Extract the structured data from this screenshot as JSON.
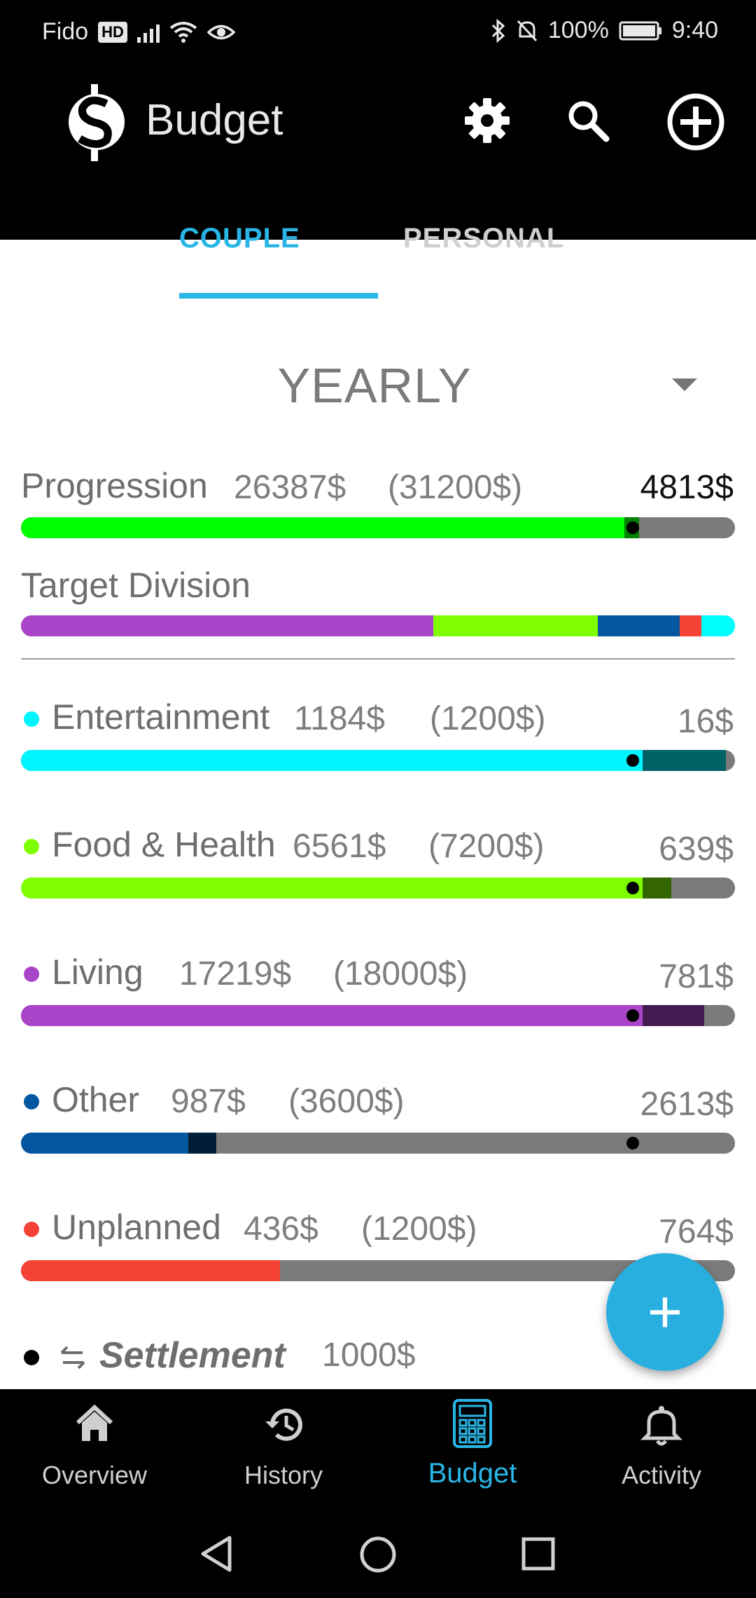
{
  "status": {
    "carrier": "Fido",
    "hd": "HD",
    "battery": "100%",
    "time": "9:40"
  },
  "appbar": {
    "title": "Budget",
    "tabs": [
      {
        "label": "COUPLE",
        "active": true
      },
      {
        "label": "PERSONAL",
        "active": false
      }
    ]
  },
  "period": {
    "selected": "YEARLY"
  },
  "progression": {
    "label": "Progression",
    "spent": "26387$",
    "target": "(31200$)",
    "remaining": "4813$",
    "fill_fraction": 0.845,
    "marker_fraction": 0.857
  },
  "target_division": {
    "label": "Target Division",
    "segments": [
      {
        "category": "Living",
        "share": 0.577,
        "color": "#aa44c8"
      },
      {
        "category": "Food & Health",
        "share": 0.231,
        "color": "#80ff00"
      },
      {
        "category": "Other",
        "share": 0.115,
        "color": "#04579f"
      },
      {
        "category": "Unplanned",
        "share": 0.03,
        "color": "#f44336"
      },
      {
        "category": "Entertainment",
        "share": 0.047,
        "color": "#00ffff"
      }
    ]
  },
  "categories": [
    {
      "name": "Entertainment",
      "spent": "1184$",
      "target": "(1200$)",
      "remaining": "16$",
      "color": "#00f6ff",
      "spent_fraction": 0.987,
      "marker_fraction": 0.857
    },
    {
      "name": "Food & Health",
      "spent": "6561$",
      "target": "(7200$)",
      "remaining": "639$",
      "color": "#80ff00",
      "spent_fraction": 0.911,
      "marker_fraction": 0.857
    },
    {
      "name": "Living",
      "spent": "17219$",
      "target": "(18000$)",
      "remaining": "781$",
      "color": "#aa44c8",
      "spent_fraction": 0.957,
      "marker_fraction": 0.857
    },
    {
      "name": "Other",
      "spent": "987$",
      "target": "(3600$)",
      "remaining": "2613$",
      "color": "#04579f",
      "spent_fraction": 0.274,
      "marker_fraction": 0.857
    },
    {
      "name": "Unplanned",
      "spent": "436$",
      "target": "(1200$)",
      "remaining": "764$",
      "color": "#f44336",
      "spent_fraction": 0.363,
      "marker_fraction": null
    }
  ],
  "settlement": {
    "label": "Settlement",
    "amount": "1000$"
  },
  "bottom_nav": [
    {
      "label": "Overview",
      "icon": "home-icon",
      "active": false
    },
    {
      "label": "History",
      "icon": "history-icon",
      "active": false
    },
    {
      "label": "Budget",
      "icon": "calculator-icon",
      "active": true
    },
    {
      "label": "Activity",
      "icon": "bell-icon",
      "active": false
    }
  ],
  "colors": {
    "accent": "#29b6e6",
    "track": "#7b7b7b",
    "progress_green": "#00ff00",
    "progress_dark_green": "#008000"
  }
}
